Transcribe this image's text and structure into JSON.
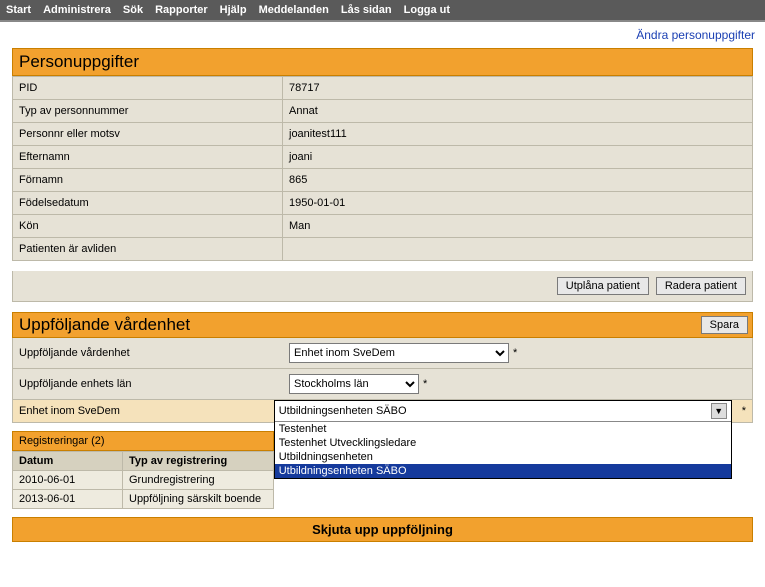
{
  "nav": {
    "items": [
      "Start",
      "Administrera",
      "Sök",
      "Rapporter",
      "Hjälp",
      "Meddelanden",
      "Lås sidan",
      "Logga ut"
    ]
  },
  "links": {
    "edit_person": "Ändra personuppgifter"
  },
  "person": {
    "header": "Personuppgifter",
    "rows": [
      {
        "label": "PID",
        "value": "78717"
      },
      {
        "label": "Typ av personnummer",
        "value": "Annat"
      },
      {
        "label": "Personnr eller motsv",
        "value": "joanitest111"
      },
      {
        "label": "Efternamn",
        "value": "joani"
      },
      {
        "label": "Förnamn",
        "value": "865"
      },
      {
        "label": "Födelsedatum",
        "value": "1950-01-01"
      },
      {
        "label": "Kön",
        "value": "Man"
      },
      {
        "label": "Patienten är avliden",
        "value": ""
      }
    ],
    "actions": {
      "utplana": "Utplåna patient",
      "radera": "Radera patient"
    }
  },
  "followup": {
    "header": "Uppföljande vårdenhet",
    "save": "Spara",
    "row1": {
      "label": "Uppföljande vårdenhet",
      "value": "Enhet inom SveDem"
    },
    "row2": {
      "label": "Uppföljande enhets län",
      "value": "Stockholms län"
    },
    "row3": {
      "label": "Enhet inom SveDem",
      "selected": "Utbildningsenheten SÄBO",
      "options": [
        "Testenhet",
        "Testenhet Utvecklingsledare",
        "Utbildningsenheten",
        "Utbildningsenheten SÄBO"
      ]
    }
  },
  "registrations": {
    "header": "Registreringar (2)",
    "columns": {
      "date": "Datum",
      "type": "Typ av registrering"
    },
    "rows": [
      {
        "date": "2010-06-01",
        "type": "Grundregistrering"
      },
      {
        "date": "2013-06-01",
        "type": "Uppföljning särskilt boende"
      }
    ]
  },
  "footer": {
    "skjuta": "Skjuta upp uppföljning"
  }
}
